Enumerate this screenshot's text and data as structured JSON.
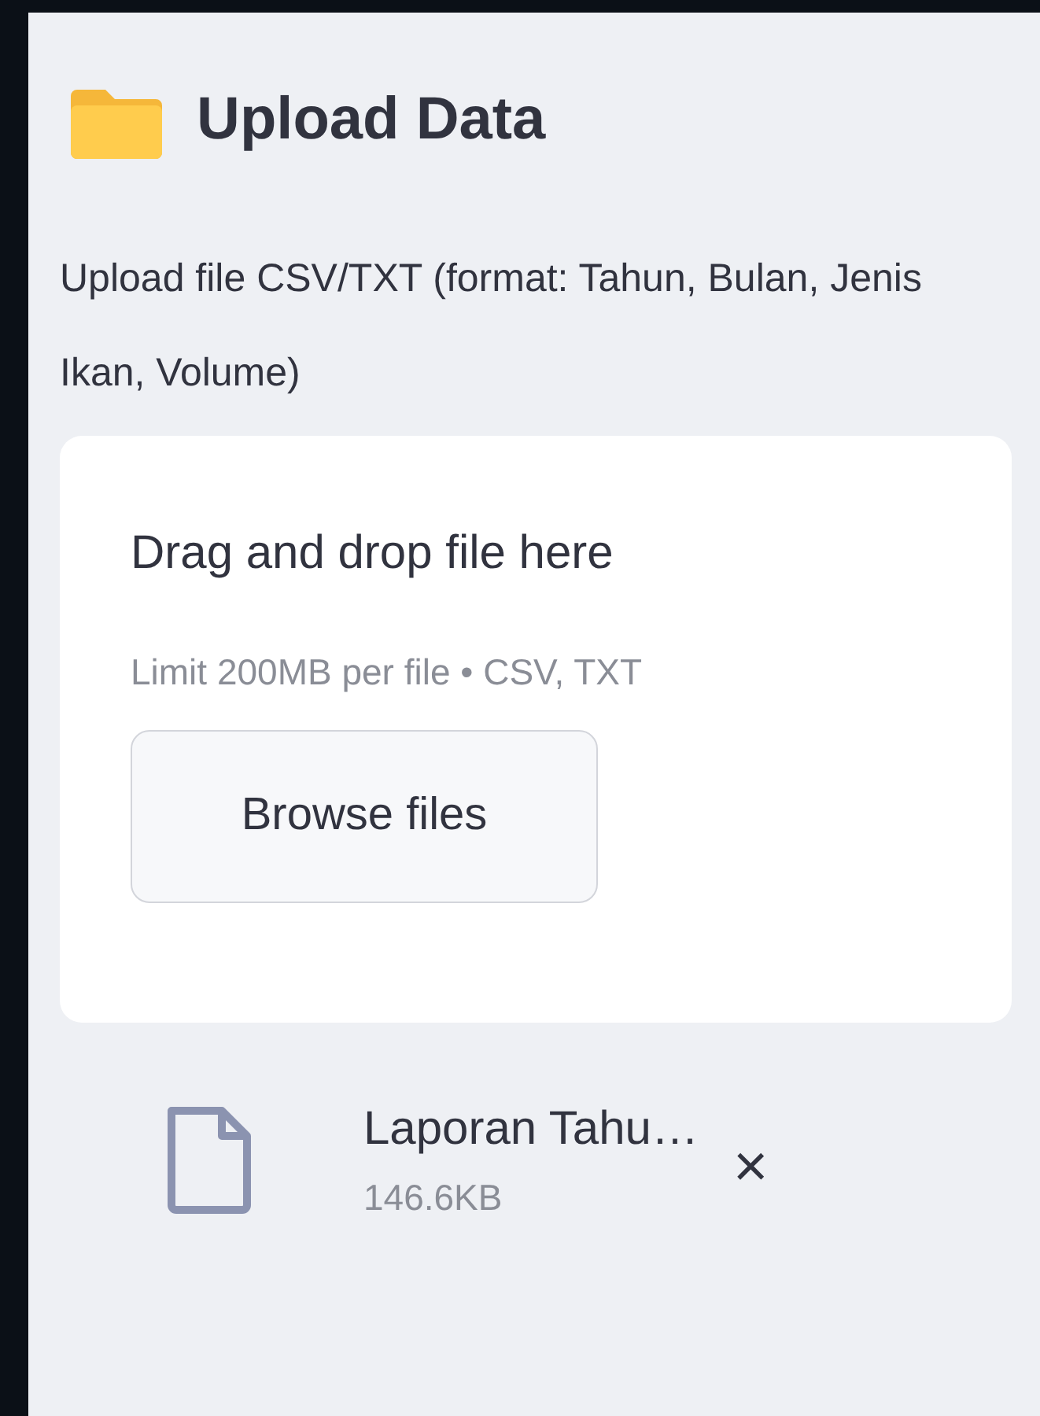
{
  "header": {
    "title": "Upload Data"
  },
  "uploader": {
    "label": "Upload file CSV/TXT (format: Tahun, Bulan, Jenis Ikan, Volume)",
    "dropzone_title": "Drag and drop file here",
    "dropzone_hint": "Limit 200MB per file • CSV, TXT",
    "button": "Browse files"
  },
  "files": [
    {
      "name": "Laporan Tahu…",
      "size": "146.6KB",
      "remove": "×"
    }
  ]
}
